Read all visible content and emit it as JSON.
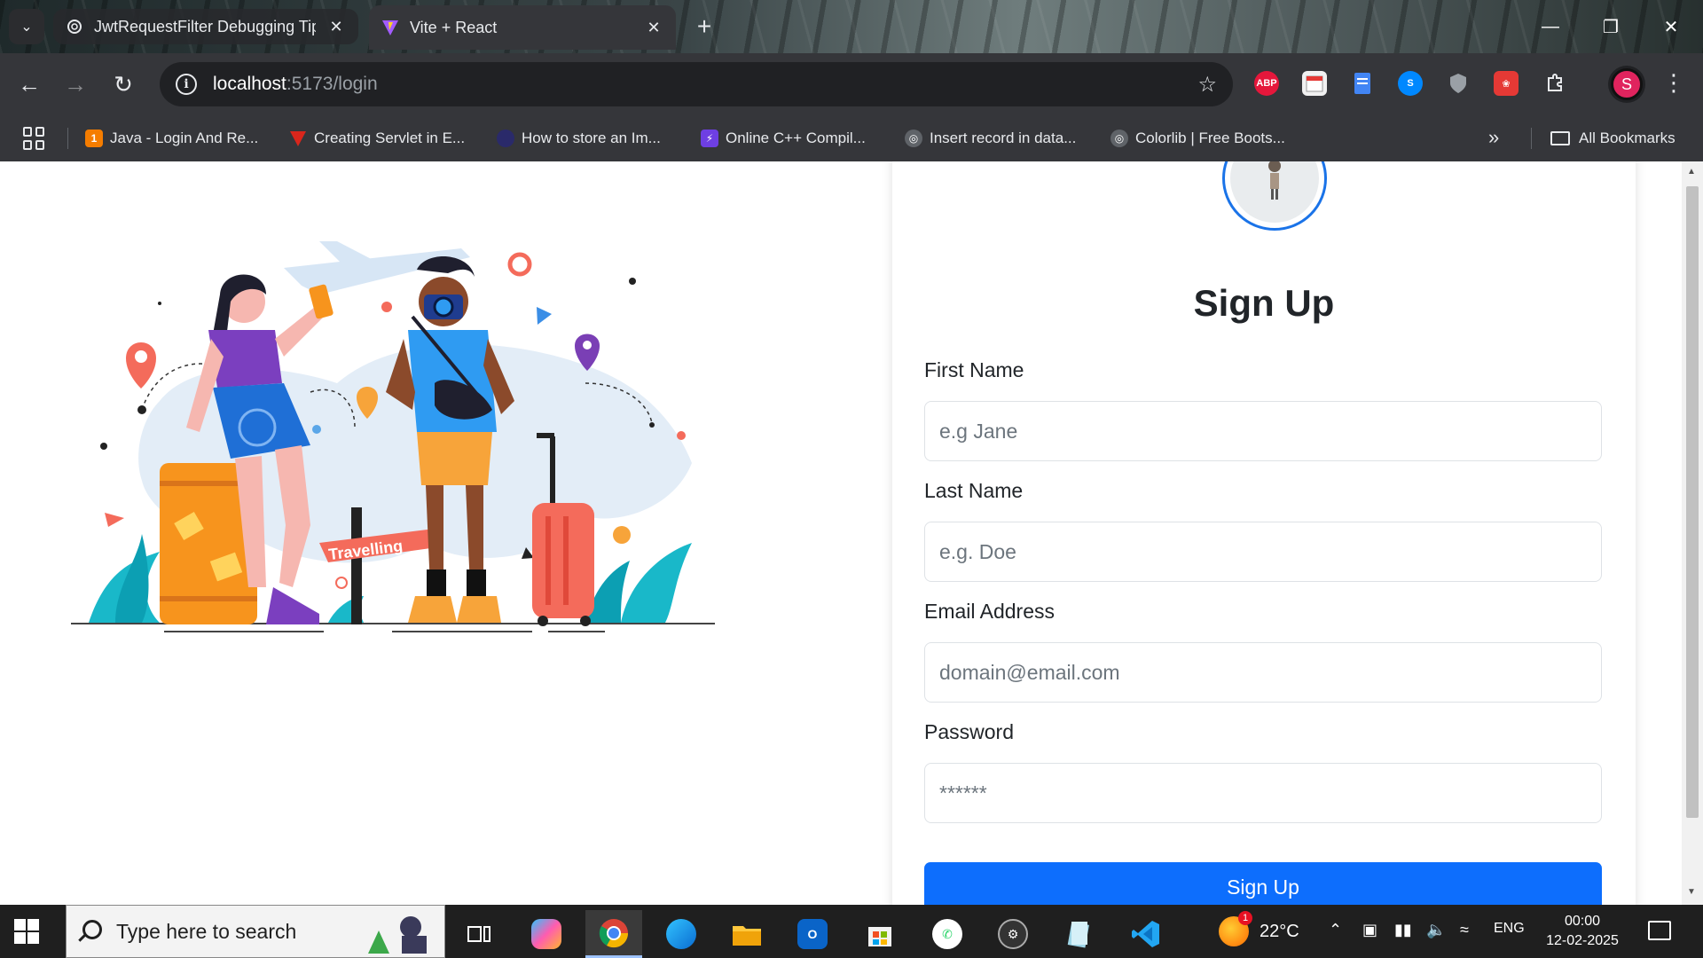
{
  "browser": {
    "tabs": [
      {
        "title": "JwtRequestFilter Debugging Tip",
        "active": false
      },
      {
        "title": "Vite + React",
        "active": true
      }
    ],
    "address": {
      "host": "localhost",
      "path": ":5173/login"
    },
    "bookmarks": [
      {
        "label": "Java - Login And Re...",
        "icon": "blogger-icon",
        "color": "#f57d00"
      },
      {
        "label": "Creating Servlet in E...",
        "icon": "javatpoint-icon",
        "color": "#d9261c"
      },
      {
        "label": "How to store an Im...",
        "icon": "stackoverflow-user-icon",
        "color": "#2a2a6a"
      },
      {
        "label": "Online C++ Compil...",
        "icon": "lightning-icon",
        "color": "#6e3fe3"
      },
      {
        "label": "Insert record in data...",
        "icon": "globe-icon",
        "color": "#5f6368"
      },
      {
        "label": "Colorlib | Free Boots...",
        "icon": "globe-icon",
        "color": "#5f6368"
      }
    ],
    "all_bookmarks_label": "All Bookmarks",
    "profile_initial": "S",
    "extensions": [
      {
        "name": "adblock-plus-icon",
        "label": "ABP",
        "color": "#e5173b"
      },
      {
        "name": "calendar-icon",
        "label": "",
        "color": "#ffffff"
      },
      {
        "name": "docs-icon",
        "label": "",
        "color": "#4285f4"
      },
      {
        "name": "shazam-icon",
        "label": "",
        "color": "#0088ff"
      },
      {
        "name": "shield-icon",
        "label": "",
        "color": "#9aa0a6"
      },
      {
        "name": "paw-icon",
        "label": "",
        "color": "#e53935"
      },
      {
        "name": "puzzle-icon",
        "label": "",
        "color": "#e8eaed"
      }
    ]
  },
  "page": {
    "illustration_label": "Travelling",
    "form": {
      "title": "Sign Up",
      "fields": [
        {
          "label": "First Name",
          "placeholder": "e.g Jane",
          "type": "text"
        },
        {
          "label": "Last Name",
          "placeholder": "e.g. Doe",
          "type": "text"
        },
        {
          "label": "Email Address",
          "placeholder": "domain@email.com",
          "type": "email"
        },
        {
          "label": "Password",
          "placeholder": "******",
          "type": "password"
        }
      ],
      "submit_label": "Sign Up"
    }
  },
  "taskbar": {
    "search_placeholder": "Type here to search",
    "weather": {
      "temp": "22°C"
    },
    "language": "ENG",
    "time": "00:00",
    "date": "12-02-2025",
    "weather_badge": "1"
  },
  "colors": {
    "primary": "#0d6efd",
    "chrome_dark": "#35363a",
    "taskbar": "#1f1f1f"
  }
}
